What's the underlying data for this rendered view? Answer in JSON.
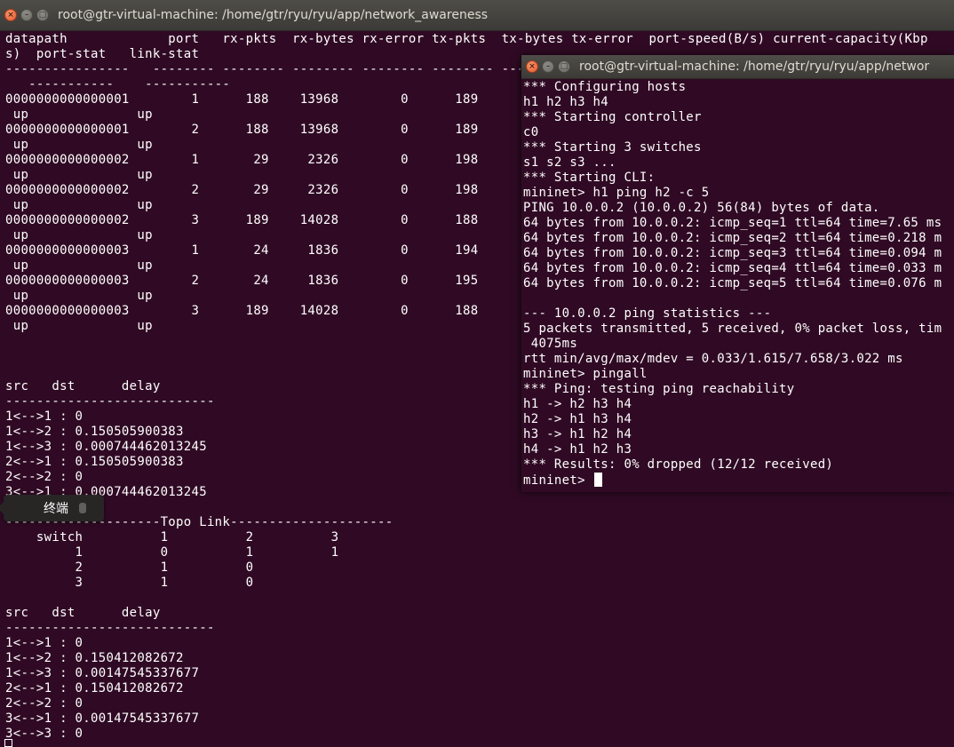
{
  "windows": {
    "back": {
      "title": "root@gtr-virtual-machine: /home/gtr/ryu/ryu/app/network_awareness",
      "lines": [
        "datapath             port   rx-pkts  rx-bytes rx-error tx-pkts  tx-bytes tx-error  port-speed(B/s) current-capacity(Kbp",
        "s)  port-stat   link-stat",
        "----------------   -------- -------- -------- -------- -------- -------- --------",
        "   -----------    -----------",
        "0000000000000001        1      188    13968        0      189",
        " up              up",
        "0000000000000001        2      188    13968        0      189",
        " up              up",
        "0000000000000002        1       29     2326        0      198",
        " up              up",
        "0000000000000002        2       29     2326        0      198",
        " up              up",
        "0000000000000002        3      189    14028        0      188",
        " up              up",
        "0000000000000003        1       24     1836        0      194",
        " up              up",
        "0000000000000003        2       24     1836        0      195",
        " up              up",
        "0000000000000003        3      189    14028        0      188",
        " up              up",
        "",
        "",
        "",
        "src   dst      delay",
        "---------------------------",
        "1<-->1 : 0",
        "1<-->2 : 0.150505900383",
        "1<-->3 : 0.000744462013245",
        "2<-->1 : 0.150505900383",
        "2<-->2 : 0",
        "3<-->1 : 0.000744462013245",
        "",
        "--------------------Topo Link---------------------",
        "    switch          1          2          3",
        "         1          0          1          1",
        "         2          1          0",
        "         3          1          0",
        "",
        "src   dst      delay",
        "---------------------------",
        "1<-->1 : 0",
        "1<-->2 : 0.150412082672",
        "1<-->3 : 0.00147545337677",
        "2<-->1 : 0.150412082672",
        "2<-->2 : 0",
        "3<-->1 : 0.00147545337677",
        "3<-->3 : 0"
      ]
    },
    "front": {
      "title": "root@gtr-virtual-machine: /home/gtr/ryu/ryu/app/networ",
      "lines": [
        "*** Configuring hosts",
        "h1 h2 h3 h4",
        "*** Starting controller",
        "c0",
        "*** Starting 3 switches",
        "s1 s2 s3 ...",
        "*** Starting CLI:",
        "mininet> h1 ping h2 -c 5",
        "PING 10.0.0.2 (10.0.0.2) 56(84) bytes of data.",
        "64 bytes from 10.0.0.2: icmp_seq=1 ttl=64 time=7.65 ms",
        "64 bytes from 10.0.0.2: icmp_seq=2 ttl=64 time=0.218 m",
        "64 bytes from 10.0.0.2: icmp_seq=3 ttl=64 time=0.094 m",
        "64 bytes from 10.0.0.2: icmp_seq=4 ttl=64 time=0.033 m",
        "64 bytes from 10.0.0.2: icmp_seq=5 ttl=64 time=0.076 m",
        "",
        "--- 10.0.0.2 ping statistics ---",
        "5 packets transmitted, 5 received, 0% packet loss, tim",
        " 4075ms",
        "rtt min/avg/max/mdev = 0.033/1.615/7.658/3.022 ms",
        "mininet> pingall",
        "*** Ping: testing ping reachability",
        "h1 -> h2 h3 h4",
        "h2 -> h1 h3 h4",
        "h3 -> h1 h2 h4",
        "h4 -> h1 h2 h3",
        "*** Results: 0% dropped (12/12 received)"
      ],
      "prompt": "mininet> "
    }
  },
  "titlebar_buttons": {
    "close": "×",
    "minimize": "–",
    "maximize": "□"
  },
  "tooltip": {
    "label": "终端"
  },
  "colors": {
    "terminal_bg": "#300a24",
    "terminal_fg": "#ffffff",
    "titlebar": "#3c3b37",
    "close_button": "#e4572e"
  }
}
